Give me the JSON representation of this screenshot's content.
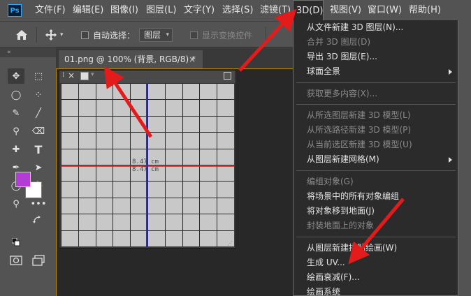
{
  "app": {
    "logo": "Ps"
  },
  "menubar": {
    "items": [
      "文件(F)",
      "编辑(E)",
      "图像(I)",
      "图层(L)",
      "文字(Y)",
      "选择(S)",
      "滤镜(T)",
      "3D(D)",
      "视图(V)",
      "窗口(W)",
      "帮助(H)"
    ]
  },
  "options": {
    "auto_select_label": "自动选择：",
    "auto_select_value": "图层",
    "show_transform_label": "显示变换控件"
  },
  "document": {
    "tab_title": "01.png @ 100% (背景, RGB/8) *",
    "close": "×"
  },
  "canvas": {
    "measure_1": "8.47 cm",
    "measure_2": "8.47 cm",
    "colors": {
      "h_line": "#d81e1e",
      "v_line": "#2a2ae0",
      "grid_bg": "#c8c8c8",
      "grid_line": "#2a2a2a"
    }
  },
  "swatches": {
    "foreground": "#b33bd6",
    "background": "#ffffff"
  },
  "dropdown": {
    "items": [
      {
        "label": "从文件新建 3D 图层(N)...",
        "disabled": false
      },
      {
        "label": "合并 3D 图层(D)",
        "disabled": true
      },
      {
        "label": "导出 3D 图层(E)...",
        "disabled": false
      },
      {
        "label": "球面全景",
        "disabled": false,
        "submenu": true
      },
      {
        "label": "获取更多内容(X)...",
        "disabled": true
      },
      {
        "label": "从所选图层新建 3D 模型(L)",
        "disabled": true
      },
      {
        "label": "从所选路径新建 3D 模型(P)",
        "disabled": true
      },
      {
        "label": "从当前选区新建 3D 模型(U)",
        "disabled": true
      },
      {
        "label": "从图层新建网格(M)",
        "disabled": false,
        "submenu": true
      },
      {
        "label": "编组对象(G)",
        "disabled": true
      },
      {
        "label": "将场景中的所有对象编组",
        "disabled": false
      },
      {
        "label": "将对象移到地面(J)",
        "disabled": false
      },
      {
        "label": "封装地面上的对象",
        "disabled": true
      },
      {
        "label": "从图层新建拼贴绘画(W)",
        "disabled": false
      },
      {
        "label": "生成 UV...",
        "disabled": false
      },
      {
        "label": "绘画衰减(F)...",
        "disabled": false
      },
      {
        "label": "绘画系统",
        "disabled": false
      }
    ]
  },
  "annotation_color": "#e31b1b",
  "tools": [
    "move-tool-icon",
    "artboard-tool-icon",
    "lasso-tool-icon",
    "quick-select-icon",
    "eyedropper-icon",
    "brush-icon",
    "stamp-icon",
    "eraser-icon",
    "healing-icon",
    "type-tool-icon",
    "pen-tool-icon",
    "path-select-icon",
    "ellipse-tool-icon",
    "hand-tool-icon",
    "zoom-tool-icon",
    "more-tools-icon"
  ]
}
